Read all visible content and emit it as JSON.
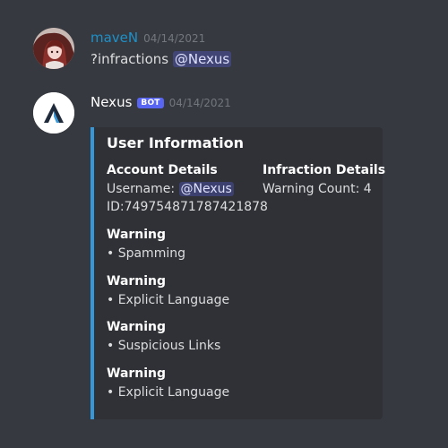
{
  "messages": [
    {
      "author": "maveN",
      "author_color": "#1e90c8",
      "timestamp": "04/14/2021",
      "content_prefix": "?infractions ",
      "mention": "@Nexus"
    },
    {
      "author": "Nexus",
      "author_color": "#ffffff",
      "bot_tag": "BOT",
      "timestamp": "04/14/2021",
      "embed": {
        "accent_color": "#3498db",
        "title": "User Information",
        "account_details": {
          "name": "Account Details",
          "username_label": "Username: ",
          "username_mention": "@Nexus",
          "id_line": "ID:749754871787421878"
        },
        "infraction_details": {
          "name": "Infraction Details",
          "warning_count": "Warning Count: 4"
        },
        "warnings": [
          {
            "name": "Warning",
            "value": "• Spamming"
          },
          {
            "name": "Warning",
            "value": "• Explicit Language"
          },
          {
            "name": "Warning",
            "value": "• Suspicious Links"
          },
          {
            "name": "Warning",
            "value": "• Explicit Language"
          }
        ]
      }
    }
  ]
}
